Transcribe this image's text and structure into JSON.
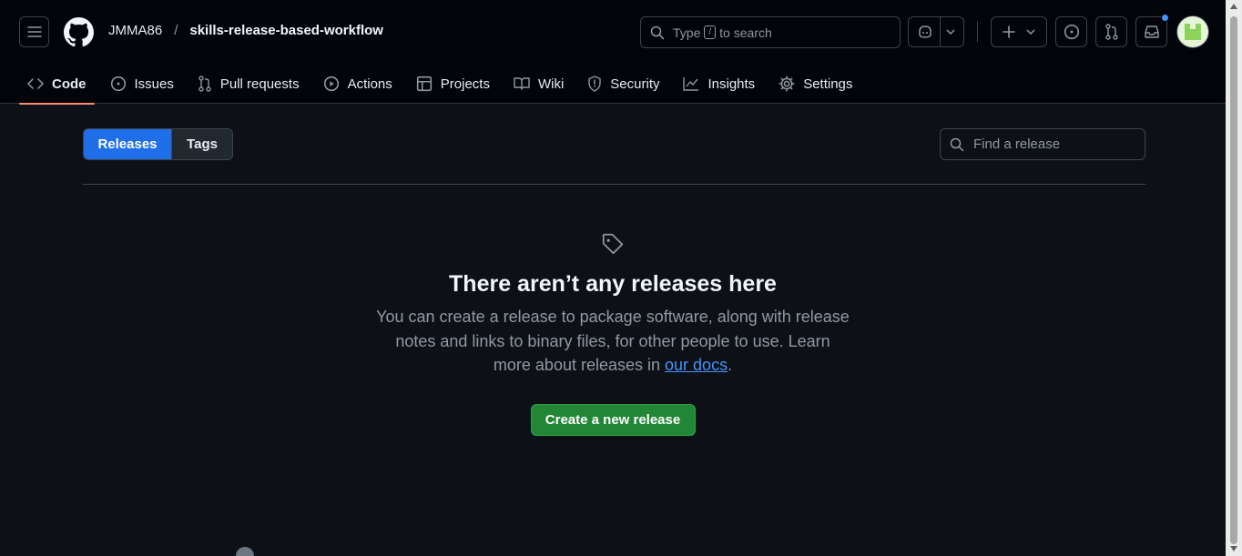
{
  "header": {
    "owner": "JMMA86",
    "separator": "/",
    "repo": "skills-release-based-workflow",
    "search_prefix": "Type",
    "search_key": "/",
    "search_suffix": "to search"
  },
  "repo_nav": [
    {
      "label": "Code",
      "icon": "code-icon",
      "selected": true
    },
    {
      "label": "Issues",
      "icon": "issue-icon"
    },
    {
      "label": "Pull requests",
      "icon": "pull-request-icon"
    },
    {
      "label": "Actions",
      "icon": "play-icon"
    },
    {
      "label": "Projects",
      "icon": "table-icon"
    },
    {
      "label": "Wiki",
      "icon": "book-icon"
    },
    {
      "label": "Security",
      "icon": "shield-icon"
    },
    {
      "label": "Insights",
      "icon": "graph-icon"
    },
    {
      "label": "Settings",
      "icon": "gear-icon"
    }
  ],
  "releases": {
    "tab_releases": "Releases",
    "tab_tags": "Tags",
    "find_placeholder": "Find a release"
  },
  "blankslate": {
    "title": "There aren’t any releases here",
    "body": "You can create a release to package software, along with release notes and links to binary files, for other people to use. Learn more about releases in",
    "link": "our docs",
    "period": ".",
    "button": "Create a new release"
  },
  "colors": {
    "accent": "#1f6feb",
    "primary_button": "#238636",
    "nav_underline": "#fd8c73",
    "link": "#4493f8"
  }
}
